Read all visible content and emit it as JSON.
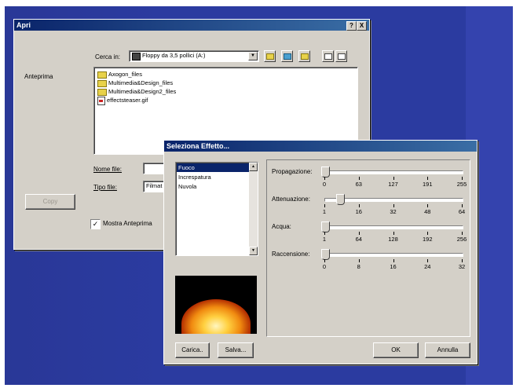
{
  "open_dialog": {
    "title": "Apri",
    "help_btn": "?",
    "close_btn": "X",
    "look_in_label": "Cerca in:",
    "look_in_value": "Floppy da 3,5 pollici (A:)",
    "preview_label": "Anteprima",
    "files": [
      {
        "name": "Axogon_files",
        "type": "folder"
      },
      {
        "name": "Multimedia&Design_files",
        "type": "folder"
      },
      {
        "name": "Multimedia&Design2_files",
        "type": "folder"
      },
      {
        "name": "effectsteaser.gif",
        "type": "gif"
      }
    ],
    "filename_label": "Nome file:",
    "filetype_label": "Tipo file:",
    "filetype_value": "Filmat",
    "copy_button": "Copy",
    "show_preview_label": "Mostra Anteprima",
    "show_preview_checked": true
  },
  "effect_dialog": {
    "title": "Seleziona Effetto...",
    "effects": [
      "Fuoco",
      "Increspatura",
      "Nuvola"
    ],
    "selected_effect": "Fuoco",
    "sliders": [
      {
        "label": "Propagazione:",
        "ticks": [
          "0",
          "63",
          "127",
          "191",
          "255"
        ],
        "value": 0
      },
      {
        "label": "Attenuazione:",
        "ticks": [
          "1",
          "16",
          "32",
          "48",
          "64"
        ],
        "value": 8
      },
      {
        "label": "Acqua:",
        "ticks": [
          "1",
          "64",
          "128",
          "192",
          "256"
        ],
        "value": 1
      },
      {
        "label": "Raccensione:",
        "ticks": [
          "0",
          "8",
          "16",
          "24",
          "32"
        ],
        "value": 0
      }
    ],
    "load_button": "Carica..",
    "save_button": "Salva...",
    "ok_button": "OK",
    "cancel_button": "Annulla"
  }
}
